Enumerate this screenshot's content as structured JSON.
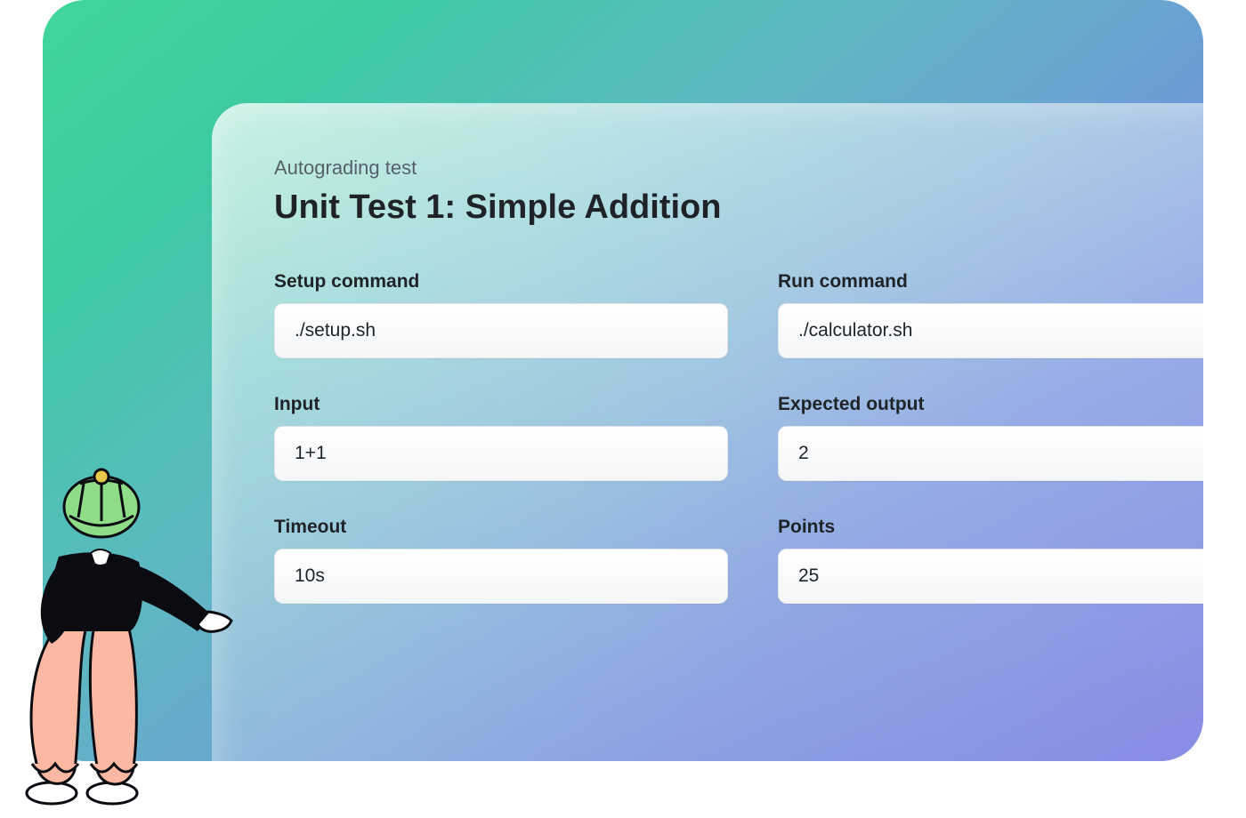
{
  "section_label": "Autograding test",
  "title": "Unit Test 1: Simple Addition",
  "fields": {
    "setup_command": {
      "label": "Setup command",
      "value": "./setup.sh"
    },
    "run_command": {
      "label": "Run command",
      "value": "./calculator.sh"
    },
    "input": {
      "label": "Input",
      "value": "1+1"
    },
    "expected_output": {
      "label": "Expected output",
      "value": "2"
    },
    "timeout": {
      "label": "Timeout",
      "value": "10s"
    },
    "points": {
      "label": "Points",
      "value": "25"
    }
  }
}
